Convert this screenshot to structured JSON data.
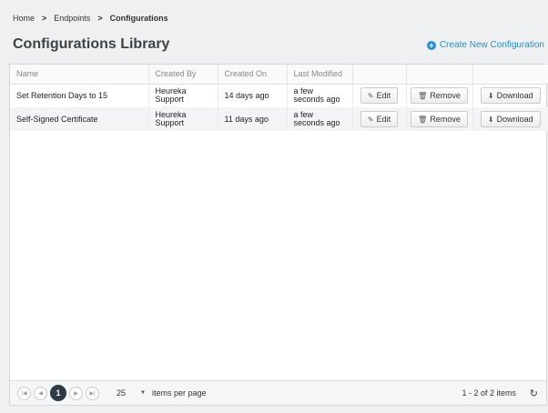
{
  "breadcrumb": {
    "home": "Home",
    "endpoints": "Endpoints",
    "current": "Configurations",
    "separator": ">"
  },
  "page_title": "Configurations Library",
  "create_link": {
    "label": "Create New Configuration",
    "icon": "plus-circle-icon",
    "color": "#2c8fc9"
  },
  "table": {
    "columns": [
      "Name",
      "Created By",
      "Created On",
      "Last Modified",
      "",
      "",
      ""
    ],
    "rows": [
      {
        "name": "Set Retention Days to 15",
        "created_by": "Heureka Support",
        "created_on": "14 days ago",
        "last_modified": "a few seconds ago",
        "edit": "Edit",
        "remove": "Remove",
        "download": "Download"
      },
      {
        "name": "Self-Signed Certificate",
        "created_by": "Heureka Support",
        "created_on": "11 days ago",
        "last_modified": "a few seconds ago",
        "edit": "Edit",
        "remove": "Remove",
        "download": "Download"
      }
    ]
  },
  "pager": {
    "current_page": "1",
    "page_size": "25",
    "items_per_page_label": "items per page",
    "items_info": "1 - 2 of 2 items"
  },
  "colors": {
    "accent": "#2c8fc9",
    "active_page": "#2e3b46",
    "background": "#eef0f1"
  }
}
